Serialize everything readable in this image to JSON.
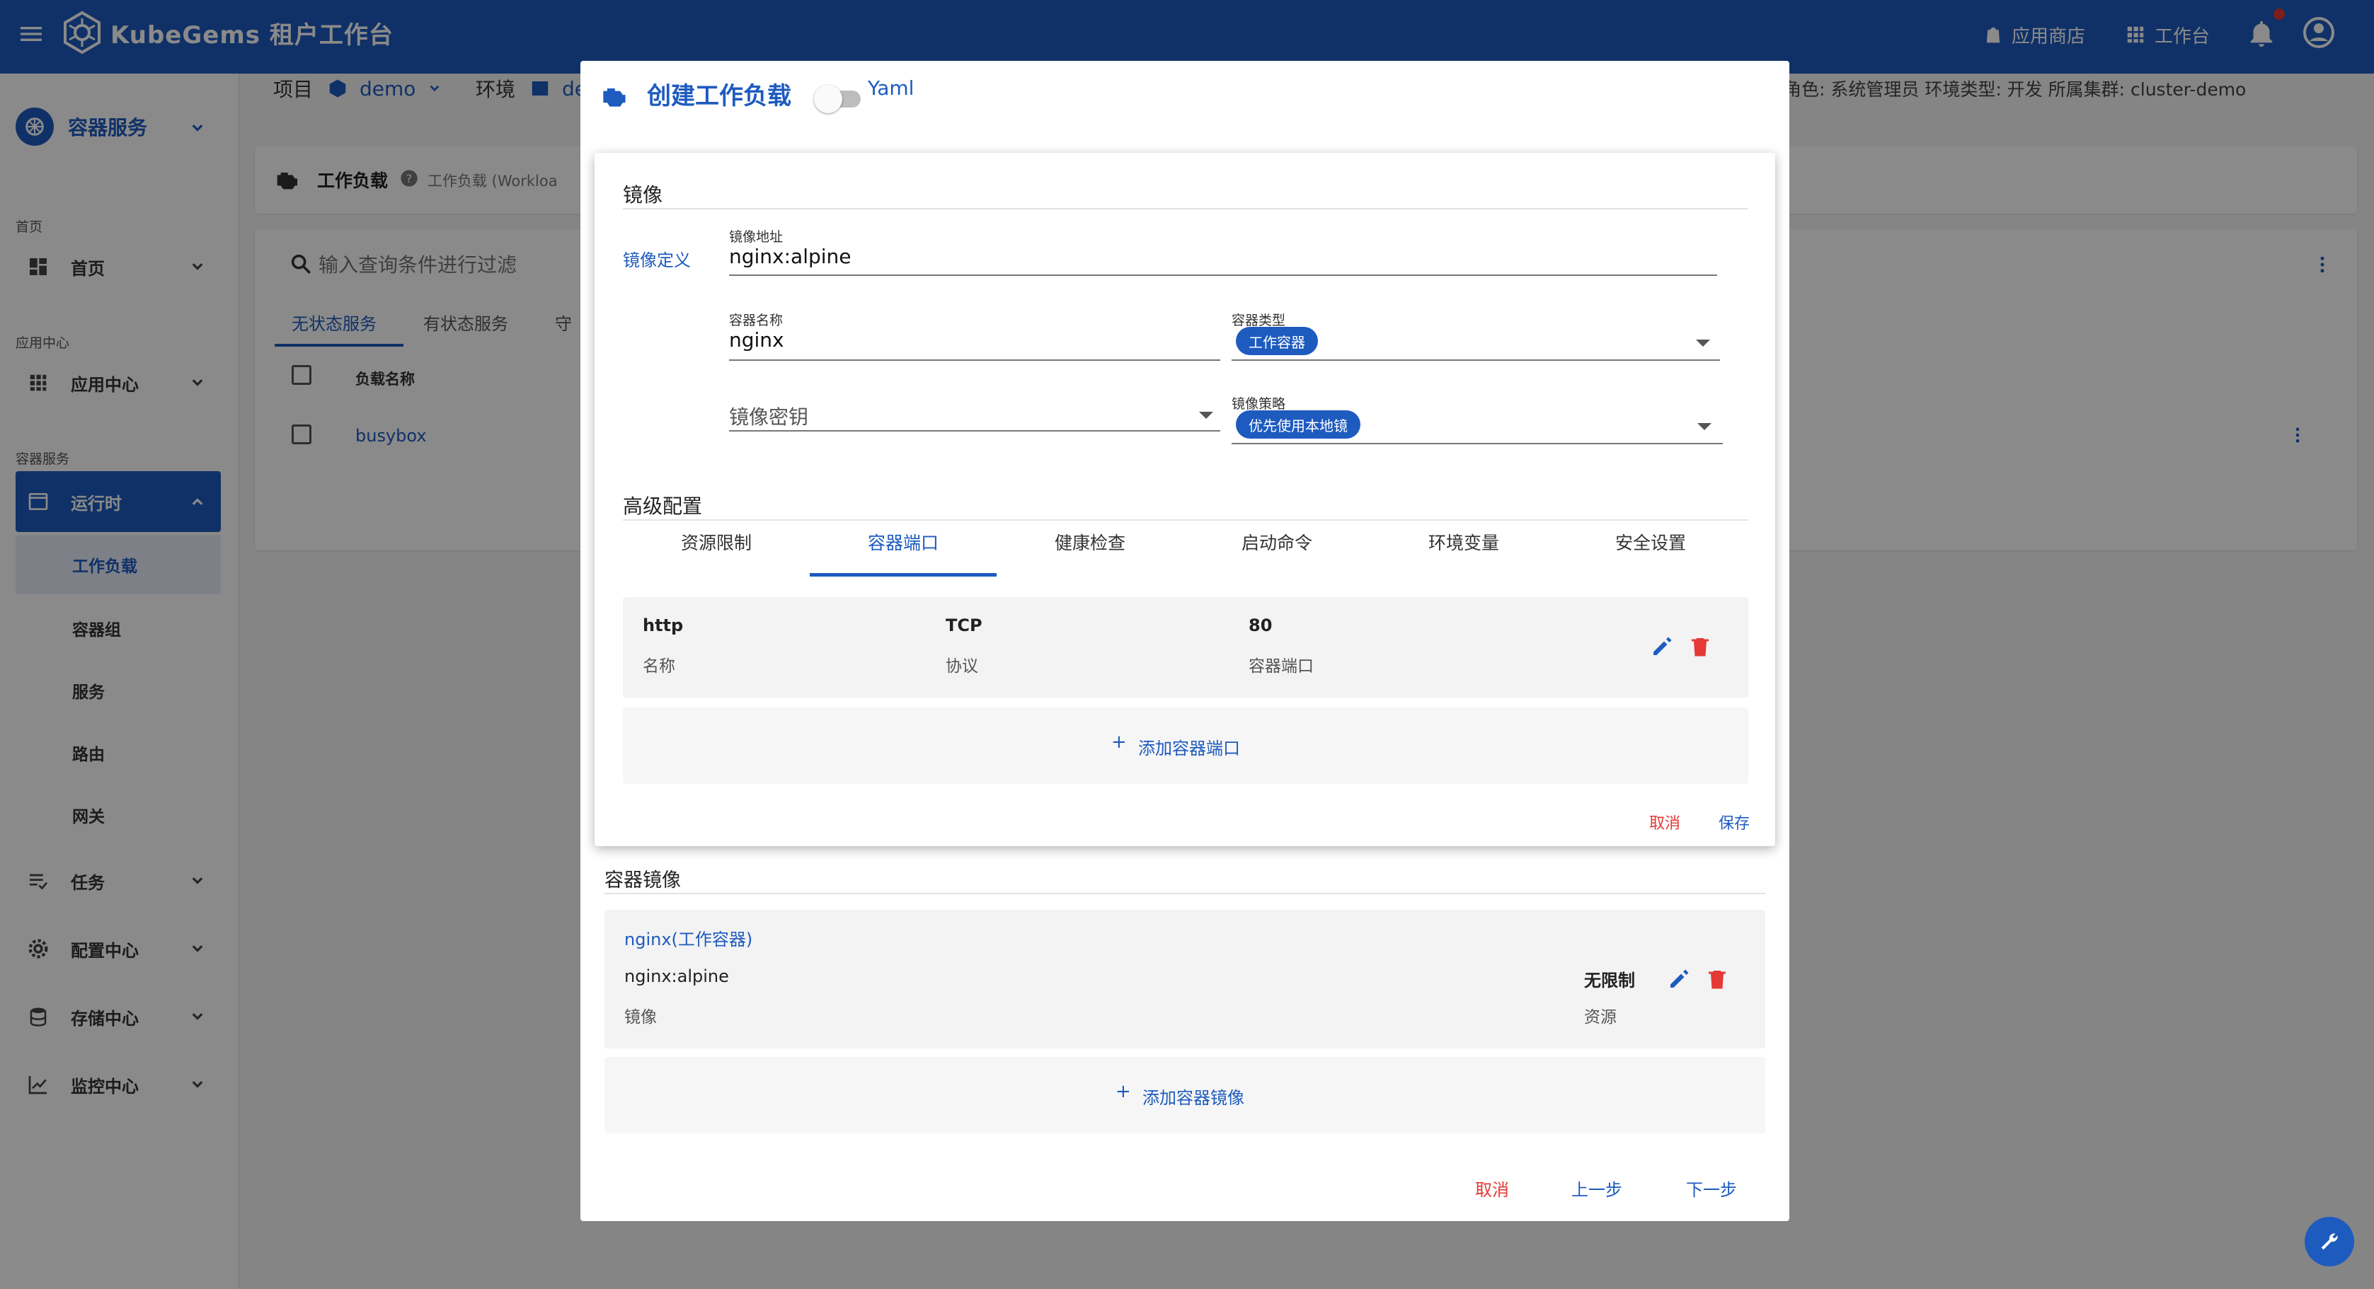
{
  "header": {
    "title": "KubeGems 租户工作台",
    "app_store": "应用商店",
    "workspace": "工作台"
  },
  "sidebar": {
    "context": "容器服务",
    "sections": {
      "home": "首页",
      "app_center": "应用中心",
      "container": "容器服务"
    },
    "items": {
      "home": "首页",
      "app_center": "应用中心",
      "runtime": "运行时",
      "workload": "工作负载",
      "pod": "容器组",
      "service": "服务",
      "route": "路由",
      "gateway": "网关",
      "task": "任务",
      "config": "配置中心",
      "storage": "存储中心",
      "monitor": "监控中心"
    }
  },
  "breadcrumb": {
    "project_label": "项目",
    "project_value": "demo",
    "env_label": "环境",
    "env_value": "de",
    "right_info": "角色: 系统管理员   环境类型: 开发   所属集群: cluster-demo"
  },
  "page": {
    "title": "工作负载",
    "subtitle": "工作负载 (Workloa",
    "search_placeholder": "输入查询条件进行过滤",
    "tabs": [
      "无状态服务",
      "有状态服务",
      "守"
    ],
    "col_name": "负载名称",
    "row_name": "busybox"
  },
  "dialog": {
    "title": "创建工作负载",
    "yaml_label": "Yaml",
    "image_section": "镜像",
    "image_def": "镜像定义",
    "image_addr_label": "镜像地址",
    "image_addr_value": "nginx:alpine",
    "container_name_label": "容器名称",
    "container_name_value": "nginx",
    "container_type_label": "容器类型",
    "container_type_value": "工作容器",
    "image_secret_placeholder": "镜像密钥",
    "image_policy_label": "镜像策略",
    "image_policy_value": "优先使用本地镜",
    "advanced_section": "高级配置",
    "tabs": [
      "资源限制",
      "容器端口",
      "健康检查",
      "启动命令",
      "环境变量",
      "安全设置"
    ],
    "port": {
      "name": "http",
      "name_label": "名称",
      "protocol": "TCP",
      "protocol_label": "协议",
      "port": "80",
      "port_label": "容器端口"
    },
    "add_port": "添加容器端口",
    "inner_cancel": "取消",
    "inner_save": "保存",
    "container_images_section": "容器镜像",
    "container_title": "nginx(工作容器)",
    "container_image": "nginx:alpine",
    "container_image_label": "镜像",
    "container_resource": "无限制",
    "container_resource_label": "资源",
    "add_image": "添加容器镜像",
    "cancel": "取消",
    "prev": "上一步",
    "next": "下一步"
  },
  "colors": {
    "primary": "#1e5bbf",
    "danger": "#e53935"
  }
}
